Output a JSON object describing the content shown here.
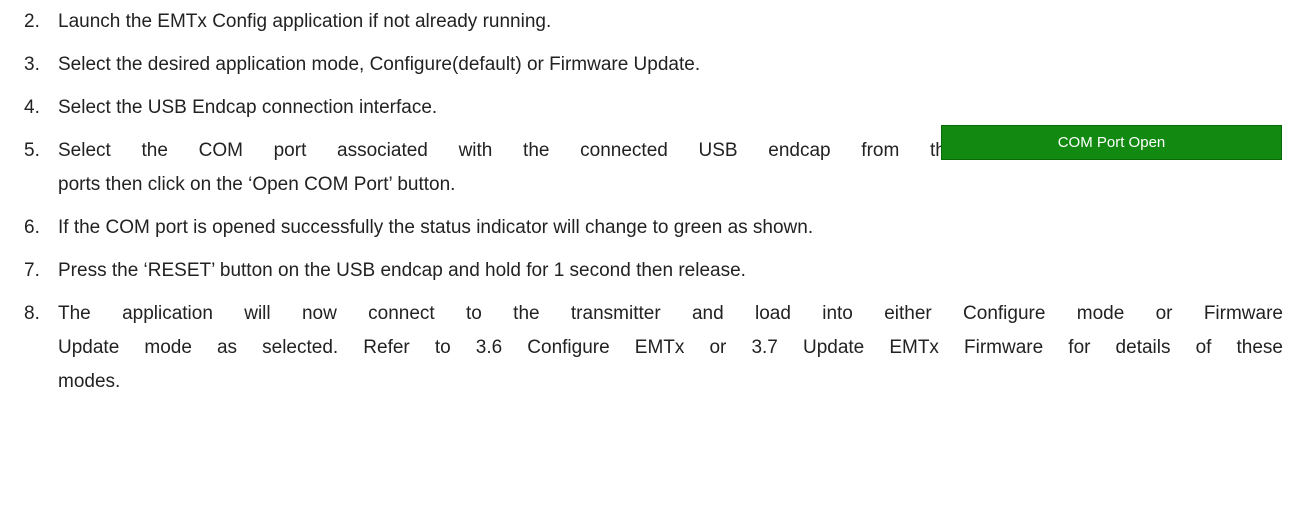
{
  "steps": [
    {
      "number": "2.",
      "lines": [
        "Launch the EMTx Config application if not already running."
      ]
    },
    {
      "number": "3.",
      "lines": [
        "Select the desired application mode, Configure(default) or Firmware Update."
      ]
    },
    {
      "number": "4.",
      "lines": [
        "Select the USB Endcap connection interface."
      ]
    },
    {
      "number": "5.",
      "lines": [
        "Select the COM port associated with the connected USB endcap from the drop-down list of available",
        "ports then click on the ‘Open COM Port’ button."
      ]
    },
    {
      "number": "6.",
      "lines": [
        "If the COM port is opened successfully the status indicator will change to green as shown."
      ]
    },
    {
      "number": "7.",
      "lines": [
        "Press the ‘RESET’ button on the USB endcap and hold for 1 second then release."
      ]
    },
    {
      "number": "8.",
      "lines": [
        "The application will now connect to the transmitter and load into either Configure mode or Firmware",
        "Update mode as selected. Refer to 3.6 Configure EMTx or 3.7 Update EMTx Firmware for details of these",
        "modes."
      ]
    }
  ],
  "status_indicator": {
    "label": "COM Port Open",
    "color": "#128a12"
  }
}
